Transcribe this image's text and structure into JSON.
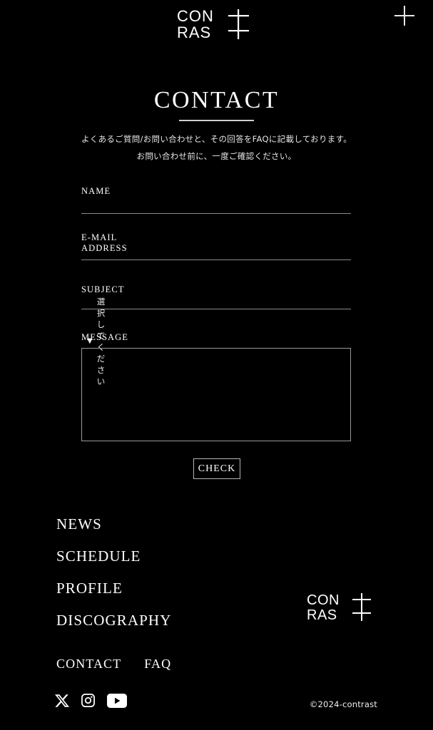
{
  "site": {
    "brand_logo_line1": "CON",
    "brand_logo_line2": "RAS",
    "accent_color": "#ffffff",
    "background_color": "#000000",
    "line_color": "#8a8a8a"
  },
  "header": {
    "menu_icon": "plus-icon",
    "logo_name": "contrast-logo"
  },
  "main": {
    "title": "CONTACT",
    "intro_line1": "よくあるご質問/お問い合わせと、その回答をFAQに記載しております。",
    "intro_line2": "お問い合わせ前に、一度ご確認ください。"
  },
  "form": {
    "name": {
      "label": "NAME",
      "value": "",
      "placeholder": ""
    },
    "email": {
      "label": "E-MAIL ADDRESS",
      "value": "",
      "placeholder": ""
    },
    "subject": {
      "label": "SUBJECT",
      "caret": "▼",
      "selected": "選択してください"
    },
    "message": {
      "label": "MESSAGE",
      "value": "",
      "placeholder": ""
    },
    "submit_label": "CHECK"
  },
  "footer": {
    "nav_main": [
      {
        "label": "NEWS"
      },
      {
        "label": "SCHEDULE"
      },
      {
        "label": "PROFILE"
      },
      {
        "label": "DISCOGRAPHY"
      }
    ],
    "nav_sub": [
      {
        "label": "CONTACT"
      },
      {
        "label": "FAQ"
      }
    ],
    "social": [
      {
        "name": "x-twitter-icon"
      },
      {
        "name": "instagram-icon"
      },
      {
        "name": "youtube-icon"
      }
    ],
    "logo_name": "contrast-logo-footer",
    "copyright": "©2024-contrast"
  }
}
